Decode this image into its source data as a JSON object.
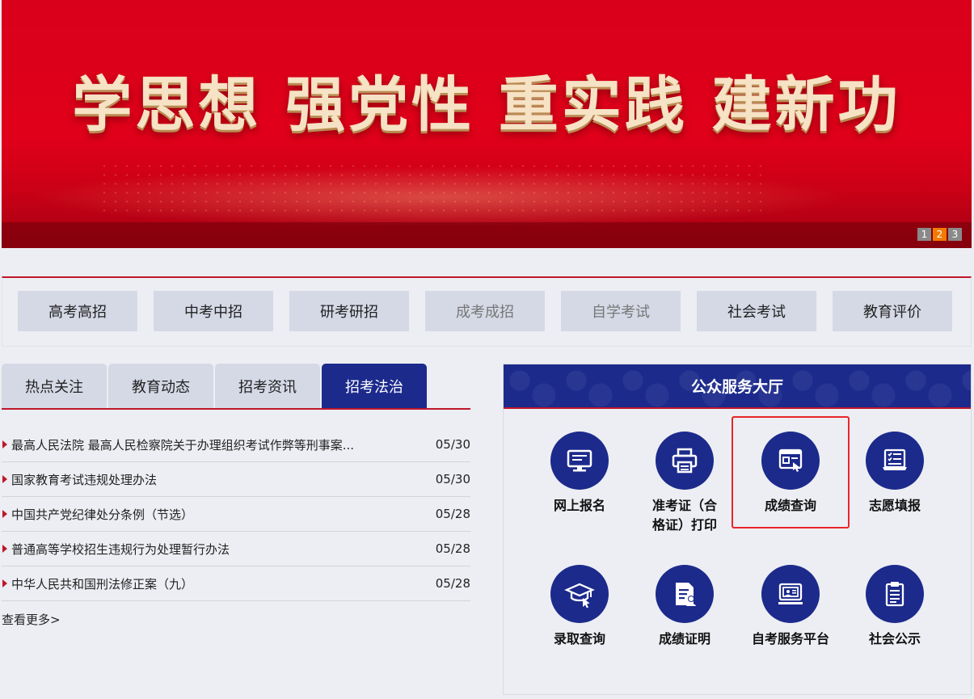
{
  "banner": {
    "slogan": "学思想  强党性  重实践  建新功",
    "pages": [
      "1",
      "2",
      "3"
    ],
    "active_page": "2",
    "colors": {
      "background": "#e1001a",
      "slogan": "#f6e2c4",
      "active_page": "#f27a00"
    }
  },
  "categories": [
    {
      "label": "高考高招",
      "muted": false
    },
    {
      "label": "中考中招",
      "muted": false
    },
    {
      "label": "研考研招",
      "muted": false
    },
    {
      "label": "成考成招",
      "muted": true
    },
    {
      "label": "自学考试",
      "muted": true
    },
    {
      "label": "社会考试",
      "muted": false
    },
    {
      "label": "教育评价",
      "muted": false
    }
  ],
  "news": {
    "tabs": [
      "热点关注",
      "教育动态",
      "招考资讯",
      "招考法治"
    ],
    "active_tab": "招考法治",
    "items": [
      {
        "title": "最高人民法院 最高人民检察院关于办理组织考试作弊等刑事案...",
        "date": "05/30"
      },
      {
        "title": "国家教育考试违规处理办法",
        "date": "05/30"
      },
      {
        "title": "中国共产党纪律处分条例（节选）",
        "date": "05/28"
      },
      {
        "title": "普通高等学校招生违规行为处理暂行办法",
        "date": "05/28"
      },
      {
        "title": "中华人民共和国刑法修正案（九）",
        "date": "05/28"
      }
    ],
    "more": "查看更多>"
  },
  "hall": {
    "title": "公众服务大厅",
    "services": [
      {
        "label": "网上报名",
        "icon": "monitor-icon"
      },
      {
        "label": "准考证（合格证）打印",
        "label_lines": [
          "准考证（合",
          "格证）打印"
        ],
        "icon": "printer-icon"
      },
      {
        "label": "成绩查询",
        "icon": "score-query-icon",
        "highlighted": true
      },
      {
        "label": "志愿填报",
        "icon": "checklist-laptop-icon"
      },
      {
        "label": "录取查询",
        "icon": "graduation-cap-icon"
      },
      {
        "label": "成绩证明",
        "icon": "certificate-icon"
      },
      {
        "label": "自考服务平台",
        "icon": "self-study-platform-icon"
      },
      {
        "label": "社会公示",
        "icon": "clipboard-icon"
      }
    ],
    "colors": {
      "circle": "#1c2a8c",
      "highlight": "#e8262a"
    }
  },
  "accent_color": "#c0162a"
}
